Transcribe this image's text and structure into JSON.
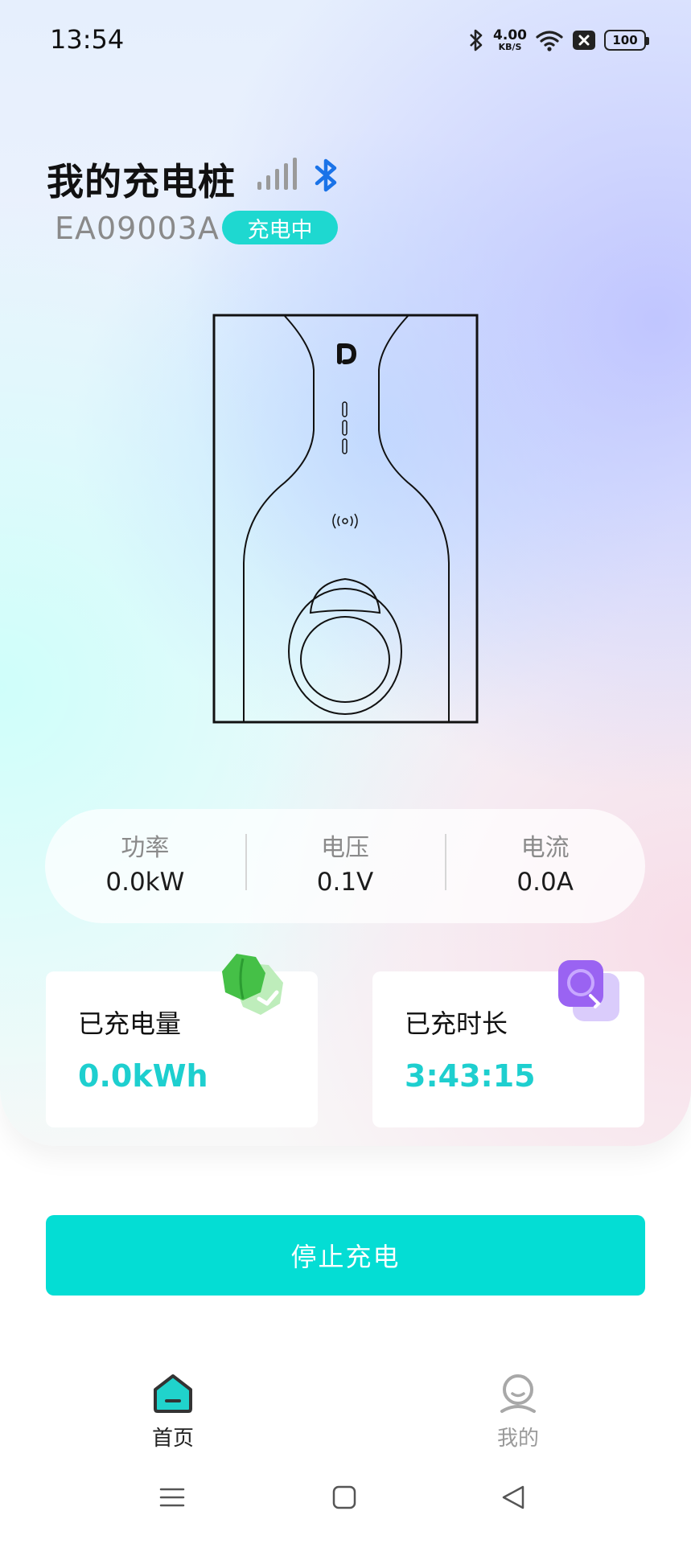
{
  "status_bar": {
    "time": "13:54",
    "net_speed_value": "4.00",
    "net_speed_unit": "KB/S",
    "battery": "100",
    "icons": [
      "bluetooth-icon",
      "wifi-icon",
      "sim-off-icon",
      "battery-icon"
    ]
  },
  "header": {
    "title": "我的充电桩",
    "device_id": "EA09003A",
    "status": "充电中",
    "icons": [
      "signal-strength-icon",
      "bluetooth-icon"
    ]
  },
  "stats": [
    {
      "label": "功率",
      "value": "0.0kW"
    },
    {
      "label": "电压",
      "value": "0.1V"
    },
    {
      "label": "电流",
      "value": "0.0A"
    }
  ],
  "cards": {
    "energy": {
      "label": "已充电量",
      "value": "0.0kWh",
      "icon": "energy-leaf-icon"
    },
    "duration": {
      "label": "已充时长",
      "value": "3:43:15",
      "icon": "clock-icon"
    }
  },
  "action": {
    "stop_label": "停止充电"
  },
  "nav": {
    "home_label": "首页",
    "mine_label": "我的"
  },
  "colors": {
    "accent": "#04ddd4",
    "value_text": "#1ecfcf",
    "bluetooth": "#1a73e8"
  }
}
